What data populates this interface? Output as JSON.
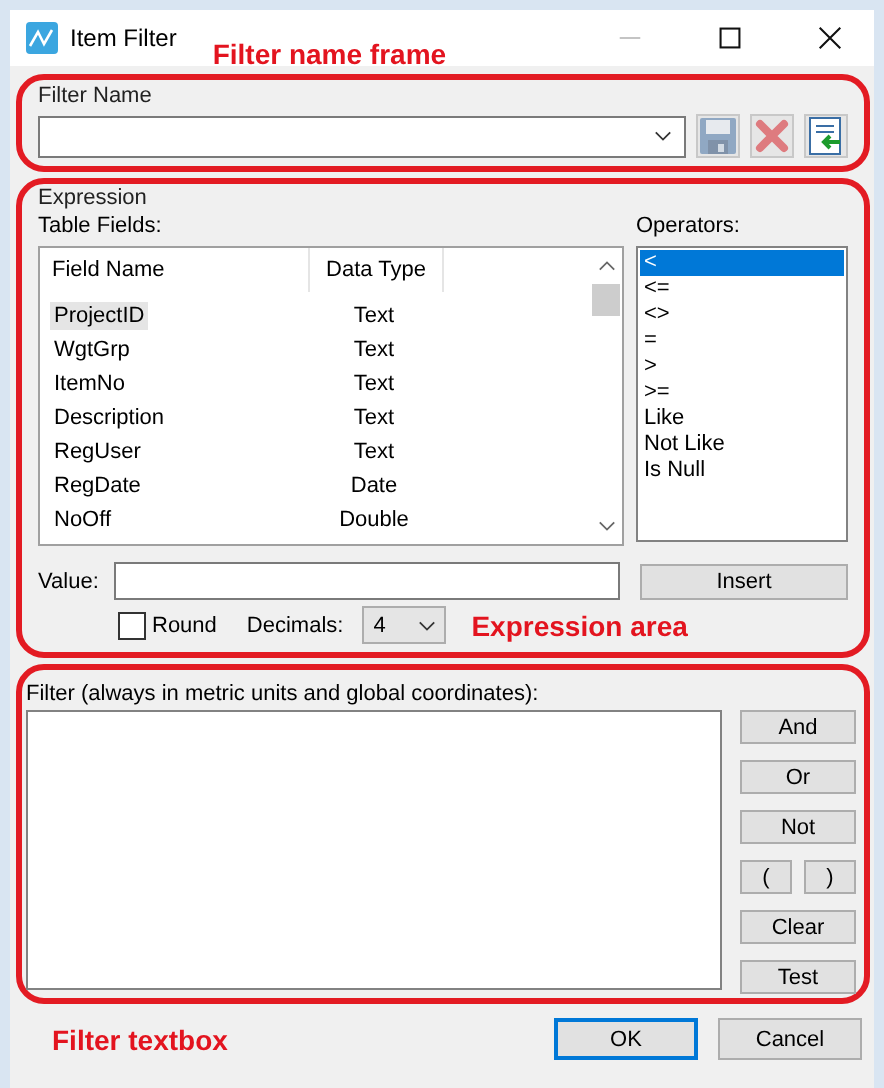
{
  "window": {
    "title": "Item Filter"
  },
  "filter_name": {
    "label": "Filter Name",
    "annotation": "Filter name frame",
    "tools": [
      {
        "kind": "save",
        "disabled": true
      },
      {
        "kind": "delete",
        "disabled": true
      },
      {
        "kind": "load",
        "disabled": false
      }
    ]
  },
  "expression": {
    "label": "Expression",
    "annotation": "Expression area",
    "table_fields_label": "Table Fields:",
    "columns": [
      "Field Name",
      "Data Type"
    ],
    "rows": [
      {
        "name": "ProjectID",
        "type": "Text",
        "selected": true
      },
      {
        "name": "WgtGrp",
        "type": "Text",
        "selected": false
      },
      {
        "name": "ItemNo",
        "type": "Text",
        "selected": false
      },
      {
        "name": "Description",
        "type": "Text",
        "selected": false
      },
      {
        "name": "RegUser",
        "type": "Text",
        "selected": false
      },
      {
        "name": "RegDate",
        "type": "Date",
        "selected": false
      },
      {
        "name": "NoOff",
        "type": "Double",
        "selected": false
      }
    ],
    "operators_label": "Operators:",
    "operators": [
      {
        "label": "<",
        "selected": true
      },
      {
        "label": "<=",
        "selected": false
      },
      {
        "label": "<>",
        "selected": false
      },
      {
        "label": "=",
        "selected": false
      },
      {
        "label": ">",
        "selected": false
      },
      {
        "label": ">=",
        "selected": false
      },
      {
        "label": "Like",
        "selected": false
      },
      {
        "label": "Not Like",
        "selected": false
      },
      {
        "label": "Is Null",
        "selected": false
      }
    ],
    "value_label": "Value:",
    "insert_button": "Insert",
    "round": {
      "label": "Round",
      "checked": false
    },
    "decimals": {
      "label": "Decimals:",
      "value": "4"
    }
  },
  "filter": {
    "label": "Filter (always in metric units and global coordinates):",
    "annotation": "Filter textbox",
    "buttons": [
      {
        "label": "And",
        "kind": "full"
      },
      {
        "label": "Or",
        "kind": "full"
      },
      {
        "label": "Not",
        "kind": "full"
      },
      {
        "label": "(",
        "kind": "half"
      },
      {
        "label": ")",
        "kind": "half"
      },
      {
        "label": "Clear",
        "kind": "full"
      },
      {
        "label": "Test",
        "kind": "full"
      }
    ]
  },
  "footer_buttons": [
    {
      "label": "OK",
      "default": true
    },
    {
      "label": "Cancel",
      "default": false
    }
  ]
}
